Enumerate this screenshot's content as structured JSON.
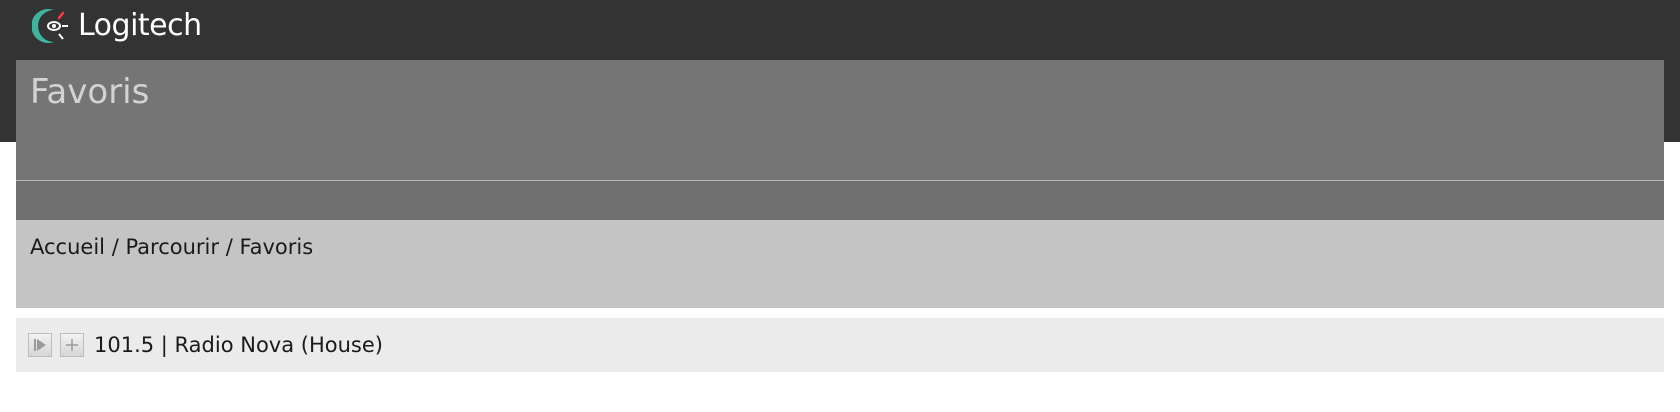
{
  "brand": {
    "name": "Logitech",
    "icon": "logitech-logo-icon",
    "colors": {
      "swirl": "#3fb39b",
      "text": "#ffffff",
      "bar": "#333333"
    }
  },
  "header": {
    "title": "Favoris"
  },
  "breadcrumb": {
    "items": [
      "Accueil",
      "Parcourir",
      "Favoris"
    ],
    "separator": "/"
  },
  "list": {
    "items": [
      {
        "label": "101.5 | Radio Nova (House)",
        "play_icon": "play-icon",
        "add_icon": "plus-icon"
      }
    ]
  }
}
